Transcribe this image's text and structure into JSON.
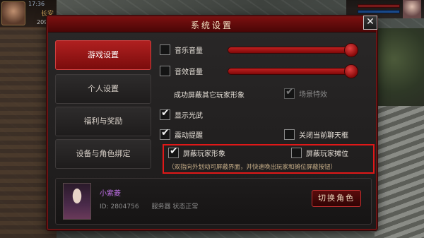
{
  "hud": {
    "time": "17:36",
    "region": "长安",
    "number": "209"
  },
  "dialog": {
    "title": "系统设置",
    "close_label": "✕"
  },
  "tabs": [
    {
      "label": "游戏设置",
      "active": true
    },
    {
      "label": "个人设置",
      "active": false
    },
    {
      "label": "福利与奖励",
      "active": false
    },
    {
      "label": "设备与角色绑定",
      "active": false
    }
  ],
  "settings": {
    "music": {
      "label": "音乐音量",
      "checked": false,
      "volume": 1.0
    },
    "sfx": {
      "label": "音效音量",
      "checked": false,
      "volume": 1.0
    },
    "hidden_notice": "成功屏蔽其它玩家形象",
    "scene_effects": {
      "label": "场景特效",
      "checked": true,
      "disabled": true
    },
    "show_glow": {
      "label": "显示光武",
      "checked": true
    },
    "vibration": {
      "label": "震动提醒",
      "checked": true
    },
    "close_chat": {
      "label": "关闭当前聊天框",
      "checked": false
    },
    "hide_players": {
      "label": "屏蔽玩家形象",
      "checked": true
    },
    "hide_stalls": {
      "label": "屏蔽玩家摊位",
      "checked": false
    },
    "hint": "（双指向外划动可屏蔽界面，并快速唤出玩家和摊位屏蔽按钮）"
  },
  "character": {
    "name": "小紫菱",
    "info": "ID: 2804756　　服务器  状态正常"
  },
  "switch_button": "切换角色",
  "colors": {
    "accent": "#b02020",
    "highlight_border": "#e01818",
    "char_name": "#c070e8"
  }
}
